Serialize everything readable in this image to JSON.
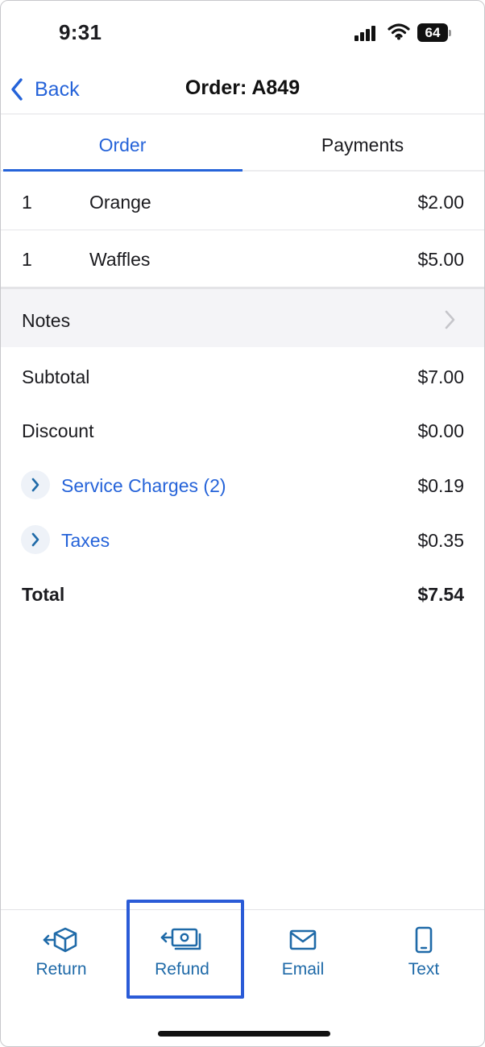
{
  "status_bar": {
    "time": "9:31",
    "battery_level": "64"
  },
  "nav": {
    "back_label": "Back",
    "title": "Order: A849"
  },
  "tabs": [
    {
      "label": "Order",
      "active": true
    },
    {
      "label": "Payments",
      "active": false
    }
  ],
  "items": [
    {
      "qty": "1",
      "name": "Orange",
      "price": "$2.00"
    },
    {
      "qty": "1",
      "name": "Waffles",
      "price": "$5.00"
    }
  ],
  "notes": {
    "label": "Notes"
  },
  "totals": {
    "subtotal": {
      "label": "Subtotal",
      "amount": "$7.00"
    },
    "discount": {
      "label": "Discount",
      "amount": "$0.00"
    },
    "service_charges": {
      "label": "Service Charges (2)",
      "amount": "$0.19"
    },
    "taxes": {
      "label": "Taxes",
      "amount": "$0.35"
    },
    "total": {
      "label": "Total",
      "amount": "$7.54"
    }
  },
  "toolbar": {
    "return": {
      "label": "Return",
      "icon": "return-box-icon"
    },
    "refund": {
      "label": "Refund",
      "icon": "refund-cash-icon"
    },
    "email": {
      "label": "Email",
      "icon": "envelope-icon"
    },
    "text": {
      "label": "Text",
      "icon": "phone-icon"
    }
  },
  "colors": {
    "accent": "#2563d9",
    "toolbar_text": "#1f6aa8",
    "highlight": "#2a5bd7",
    "notes_bg": "#f4f4f7"
  }
}
